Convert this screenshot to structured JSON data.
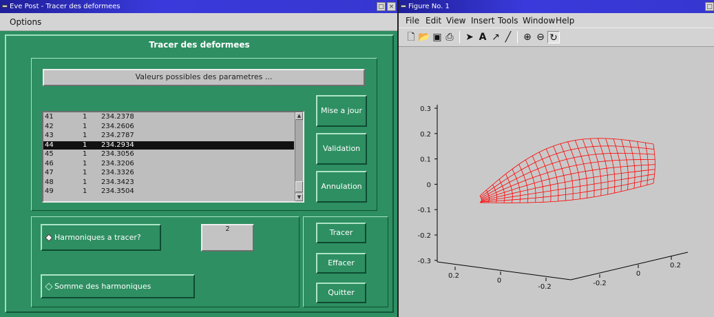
{
  "left_window": {
    "title": "Eve Post - Tracer des deformees",
    "menu": {
      "options": "Options"
    },
    "panel_title": "Tracer des deformees",
    "params_label": "Valeurs possibles des parametres ...",
    "list_rows": [
      [
        "41",
        "1",
        "234.2378"
      ],
      [
        "42",
        "1",
        "234.2606"
      ],
      [
        "43",
        "1",
        "234.2787"
      ],
      [
        "44",
        "1",
        "234.2934"
      ],
      [
        "45",
        "1",
        "234.3056"
      ],
      [
        "46",
        "1",
        "234.3206"
      ],
      [
        "47",
        "1",
        "234.3326"
      ],
      [
        "48",
        "1",
        "234.3423"
      ],
      [
        "49",
        "1",
        "234.3504"
      ]
    ],
    "selected_row_index": 3,
    "buttons": {
      "mise_a_jour": "Mise a jour",
      "validation": "Validation",
      "annulation": "Annulation",
      "tracer": "Tracer",
      "effacer": "Effacer",
      "quitter": "Quitter"
    },
    "radio_harmoniques": "Harmoniques  a  tracer?",
    "radio_somme": "Somme des harmoniques",
    "harmonics_value": "2"
  },
  "right_window": {
    "title": "Figure No. 1",
    "menu": [
      "File",
      "Edit",
      "View",
      "Insert",
      "Tools",
      "Window",
      "Help"
    ],
    "toolbar_icons": [
      "new-file-icon",
      "open-folder-icon",
      "save-icon",
      "print-icon",
      "select-arrow-icon",
      "text-icon",
      "arrow-icon",
      "line-icon",
      "zoom-in-icon",
      "zoom-out-icon",
      "rotate-3d-icon"
    ]
  },
  "chart_data": {
    "type": "surface3d",
    "z_ticks": [
      "0.3",
      "0.2",
      "0.1",
      "0",
      "-0.1",
      "-0.2",
      "-0.3"
    ],
    "x_ticks": [
      "0.2",
      "0",
      "-0.2"
    ],
    "y_ticks": [
      "-0.2",
      "0",
      "0.2"
    ],
    "color": "#ff0000"
  }
}
